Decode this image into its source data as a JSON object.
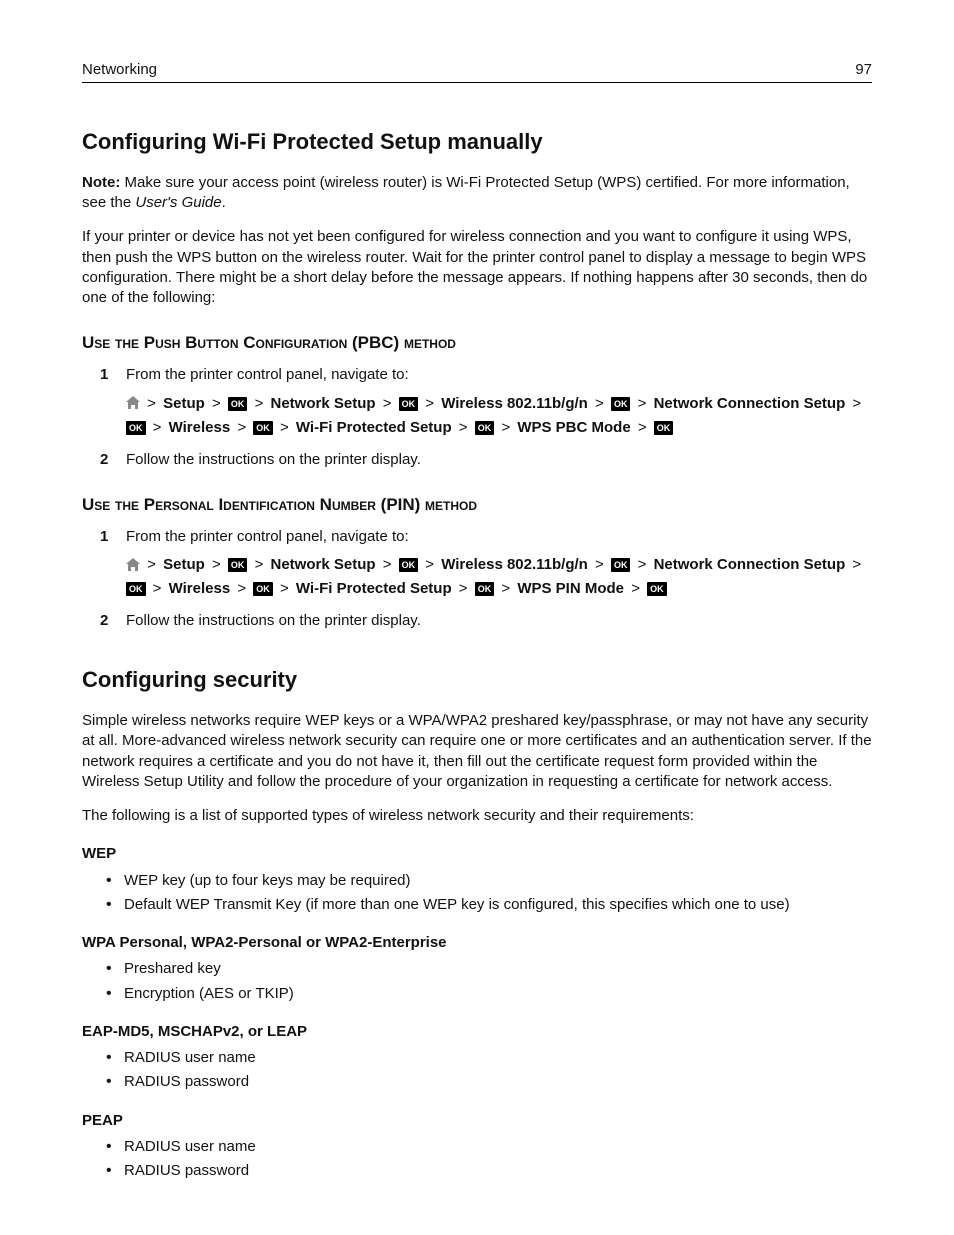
{
  "header": {
    "section": "Networking",
    "page": "97"
  },
  "sec1": {
    "title": "Configuring Wi-Fi Protected Setup manually",
    "note_label": "Note:",
    "note_body": " Make sure your access point (wireless router) is Wi-Fi Protected Setup (WPS) certified. For more information, see the ",
    "note_ug": "User's Guide",
    "intro": "If your printer or device has not yet been configured for wireless connection and you want to configure it using WPS, then push the WPS button on the wireless router. Wait for the printer control panel to display a message to begin WPS configuration. There might be a short delay before the message appears. If nothing happens after 30 seconds, then do one of the following:",
    "pbc": {
      "title": "Use the Push Button Configuration (PBC) method",
      "step1": "From the printer control panel, navigate to:",
      "path": {
        "setup": "Setup",
        "network_setup": "Network Setup",
        "wireless_band": "Wireless 802.11b/g/n",
        "ncs": "Network Connection Setup",
        "wireless": "Wireless",
        "wps": "Wi-Fi Protected Setup",
        "mode": "WPS PBC Mode"
      },
      "step2": "Follow the instructions on the printer display."
    },
    "pin": {
      "title": "Use the Personal Identification Number (PIN) method",
      "step1": "From the printer control panel, navigate to:",
      "path": {
        "setup": "Setup",
        "network_setup": "Network Setup",
        "wireless_band": "Wireless 802.11b/g/n",
        "ncs": "Network Connection Setup",
        "wireless": "Wireless",
        "wps": "Wi-Fi Protected Setup",
        "mode": "WPS PIN Mode"
      },
      "step2": "Follow the instructions on the printer display."
    }
  },
  "sec2": {
    "title": "Configuring security",
    "p1": "Simple wireless networks require WEP keys or a WPA/WPA2 preshared key/passphrase, or may not have any security at all. More-advanced wireless network security can require one or more certificates and an authentication server. If the network requires a certificate and you do not have it, then fill out the certificate request form provided within the Wireless Setup Utility and follow the procedure of your organization in requesting a certificate for network access.",
    "p2": "The following is a list of supported types of wireless network security and their requirements:",
    "wep": {
      "title": "WEP",
      "items": [
        "WEP key (up to four keys may be required)",
        "Default WEP Transmit Key (if more than one WEP key is configured, this specifies which one to use)"
      ]
    },
    "wpa": {
      "title": "WPA Personal, WPA2-Personal or WPA2-Enterprise",
      "items": [
        "Preshared key",
        "Encryption (AES or TKIP)"
      ]
    },
    "eap": {
      "title": "EAP-MD5, MSCHAPv2, or LEAP",
      "items": [
        "RADIUS user name",
        "RADIUS password"
      ]
    },
    "peap": {
      "title": "PEAP",
      "items": [
        "RADIUS user name",
        "RADIUS password"
      ]
    }
  },
  "glyph": {
    "ok": "OK",
    "gt": ">"
  }
}
